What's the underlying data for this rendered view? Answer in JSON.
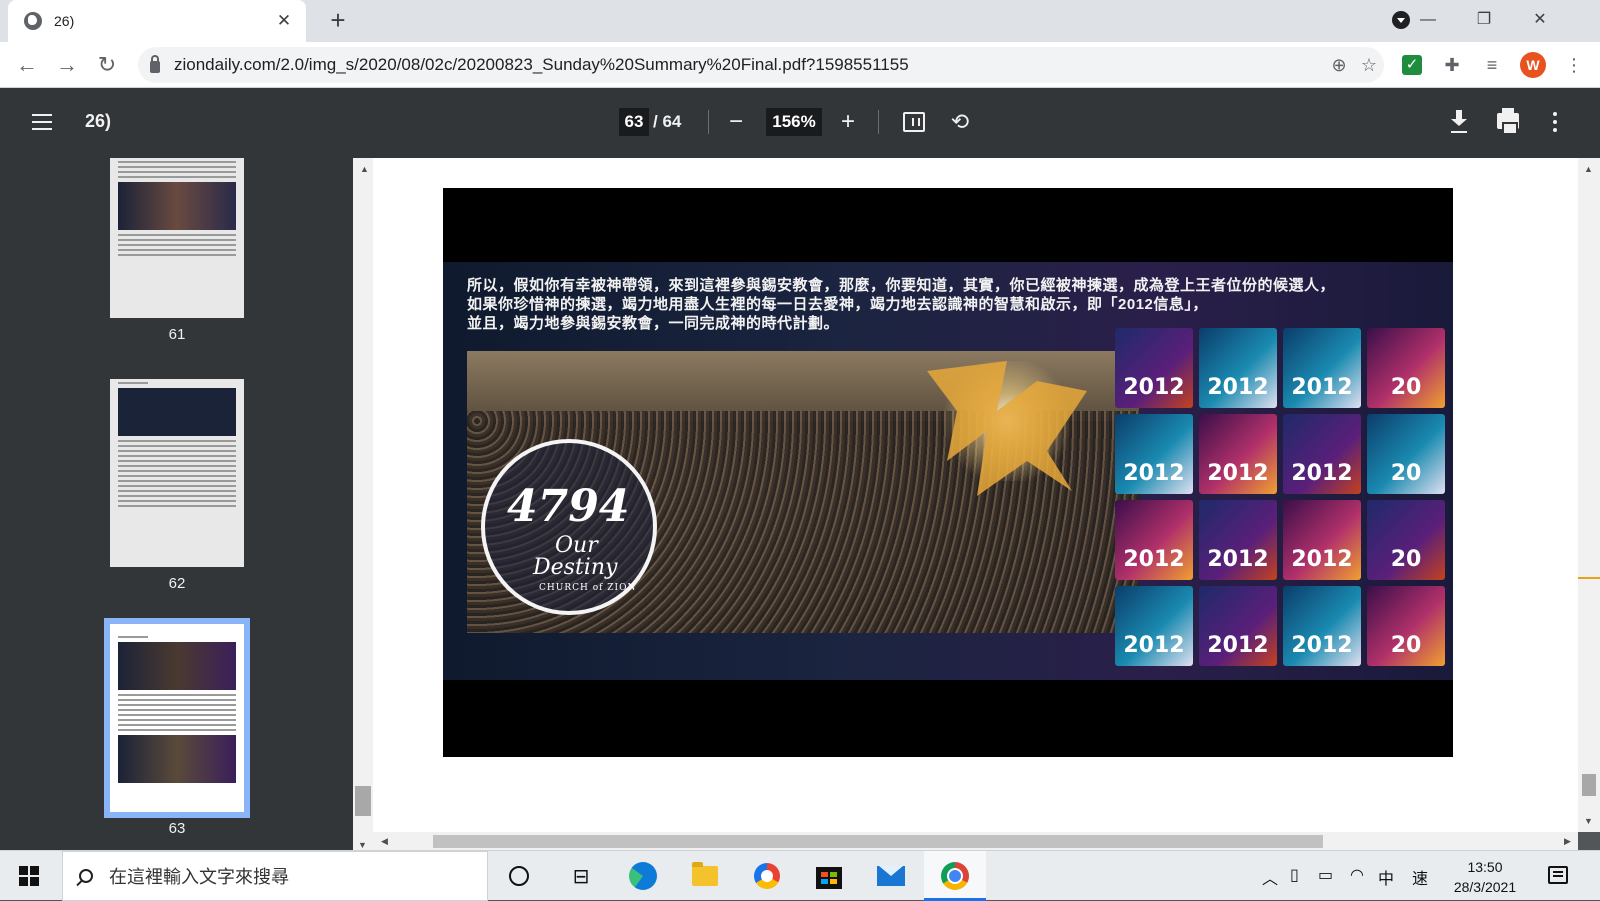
{
  "browser": {
    "tab_title": "26)",
    "tab_close": "✕",
    "new_tab": "+",
    "window_minimize": "—",
    "window_restore": "❐",
    "window_close": "✕",
    "url": "ziondaily.com/2.0/img_s/2020/08/02c/20200823_Sunday%20Summary%20Final.pdf?1598551155",
    "avatar_letter": "W"
  },
  "pdf_toolbar": {
    "title": "26)",
    "current_page": "63",
    "total_pages": "/ 64",
    "zoom_out": "−",
    "zoom": "156%",
    "zoom_in": "+"
  },
  "thumbnails": [
    {
      "page": "61"
    },
    {
      "page": "62"
    },
    {
      "page": "63"
    }
  ],
  "slide": {
    "caption_lines": [
      "所以，假如你有幸被神帶領，來到這裡參與錫安教會，那麼，你要知道，其實，你已經被神揀選，成為登上王者位份的候選人，",
      "如果你珍惜神的揀選，竭力地用盡人生裡的每一日去愛神，竭力地去認識神的智慧和啟示，即「2012信息」，",
      "並且，竭力地參與錫安教會，一同完成神的時代計劃。"
    ],
    "logo_number": "4794",
    "logo_line1": "Our",
    "logo_line2": "Destiny",
    "logo_church": "CHURCH of ZION",
    "tiles": [
      "2012",
      "2012",
      "2012",
      "20",
      "2012",
      "2012",
      "2012",
      "20",
      "2012",
      "2012",
      "2012",
      "20",
      "2012",
      "2012",
      "2012",
      "20"
    ]
  },
  "taskbar": {
    "search_placeholder": "在這裡輸入文字來搜尋",
    "ime_lang": "中",
    "ime_mode": "速",
    "time": "13:50",
    "date": "28/3/2021"
  }
}
